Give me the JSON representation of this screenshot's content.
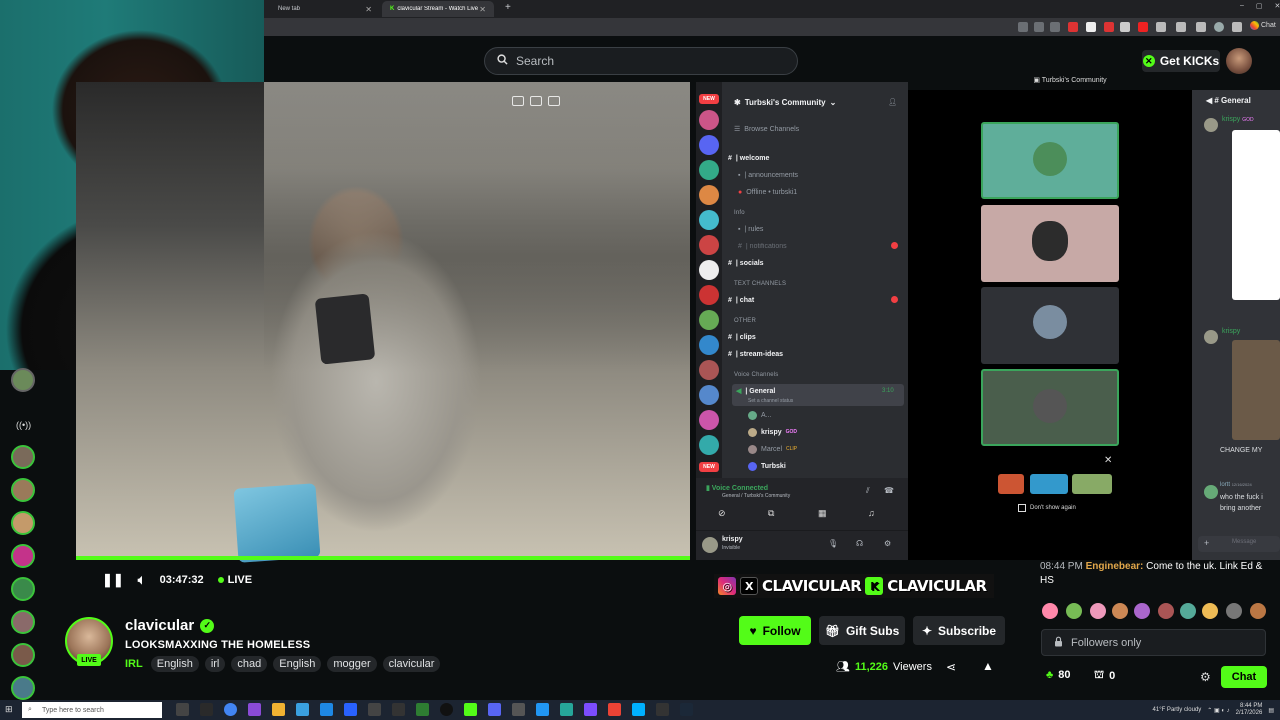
{
  "browser": {
    "tabs": [
      {
        "label": "New tab"
      },
      {
        "label": "clavicular Stream - Watch Live"
      }
    ]
  },
  "header": {
    "search_placeholder": "Search",
    "get_kicks_label": "Get KICKs"
  },
  "player": {
    "elapsed": "03:47:32",
    "live_label": "LIVE"
  },
  "discord": {
    "server_badges": [
      "NEW",
      "NEW"
    ],
    "community_name": "Turbski's Community",
    "window_title": "Turbski's Community",
    "browse_channels": "Browse Channels",
    "channels": [
      {
        "name": "| welcome"
      },
      {
        "name": "| announcements"
      },
      {
        "name": "Offline • turbski1"
      }
    ],
    "cat_info": "Info",
    "info_channels": [
      {
        "name": "| rules"
      },
      {
        "name": "| notifications"
      },
      {
        "name": "| socials"
      }
    ],
    "cat_text": "TEXT CHANNELS",
    "text_channels": [
      {
        "name": "| chat"
      }
    ],
    "cat_other": "OTHER",
    "other_channels": [
      {
        "name": "| clips"
      },
      {
        "name": "| stream-ideas"
      }
    ],
    "cat_voice": "Voice Channels",
    "voice_channel": "| General",
    "voice_status": "Set a channel status",
    "voice_timer": "3:10",
    "voice_members": [
      {
        "name": "A..."
      },
      {
        "name": "krispy",
        "tag": "GOD"
      },
      {
        "name": "Marcel",
        "tag": "CLIP"
      },
      {
        "name": "Turbski"
      }
    ],
    "voice_connected": "Voice Connected",
    "voice_path": "General / Turbski's Community",
    "user_name": "krispy",
    "user_status": "Invisible",
    "dont_show": "Don't show again",
    "right_channel": "General",
    "right_msgs": [
      {
        "author": "krispy",
        "tag": "GOD"
      },
      {
        "author": "krispy"
      },
      {
        "text": "CHANGE MY"
      },
      {
        "author": "lortt",
        "time": "12/16/2024",
        "text": "who the fuck i bring another"
      }
    ],
    "message_placeholder": "Message"
  },
  "overlay": {
    "handle_1": "CLAVICULAR",
    "handle_2": "CLAVICULAR"
  },
  "chat": {
    "message": {
      "time": "08:44 PM",
      "user": "Enginebear:",
      "text": "Come to the uk. Link Ed & HS"
    },
    "followers_only": "Followers only",
    "send_label": "Chat"
  },
  "channel": {
    "name": "clavicular",
    "live_badge": "LIVE",
    "title": "LOOKSMAXXING THE HOMELESS",
    "category": "IRL",
    "tags": [
      "English",
      "irl",
      "chad",
      "English",
      "mogger",
      "clavicular"
    ],
    "follow_label": "Follow",
    "gift_label": "Gift Subs",
    "subscribe_label": "Subscribe",
    "viewers_count": "11,226",
    "viewers_label": "Viewers",
    "points": "80",
    "drops": "0"
  },
  "taskbar": {
    "search_placeholder": "Type here to search",
    "weather": "41°F Partly cloudy",
    "time": "8:44 PM",
    "date": "2/17/2026"
  },
  "colors": {
    "kick_green": "#53fc18",
    "discord_bg": "#2b2d31",
    "discord_dark": "#1e1f22"
  }
}
